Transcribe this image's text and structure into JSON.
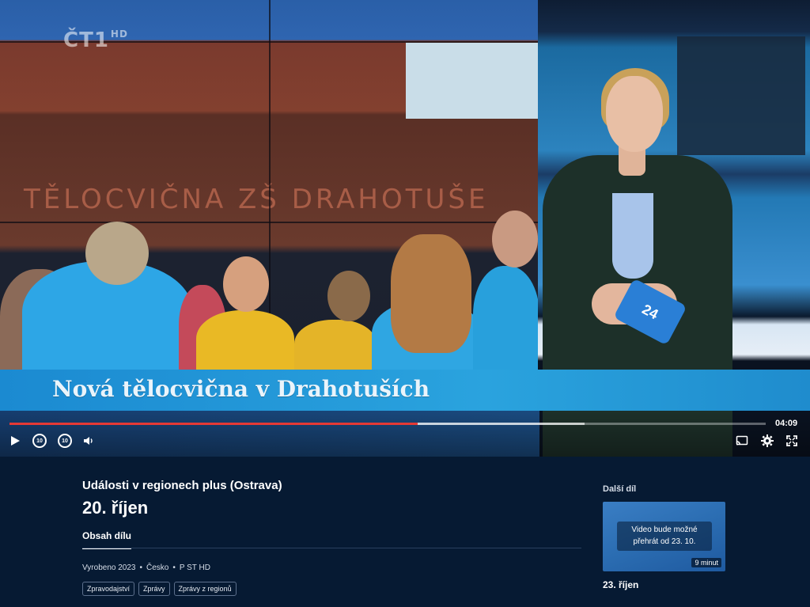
{
  "player": {
    "channel_logo": "ČT1",
    "channel_logo_hd": "HD",
    "background_sign": "TĚLOCVIČNA ZŠ DRAHOTUŠE",
    "studio_card": "24",
    "lower_third": "Nová tělocvična v Drahotuších",
    "time": "04:09",
    "progress": 0.54,
    "buffered": 0.76,
    "controls": {
      "play_icon": "play-icon",
      "rewind_label": "10",
      "forward_label": "10",
      "volume_icon": "volume-icon",
      "cast_icon": "cast-icon",
      "settings_icon": "gear-icon",
      "fullscreen_icon": "fullscreen-icon"
    },
    "accent_color": "#e53935"
  },
  "episode": {
    "show_title": "Události v regionech plus (Ostrava)",
    "title": "20. říjen",
    "tab": "Obsah dílu",
    "meta": [
      "Vyrobeno 2023",
      "Česko",
      "P ST HD"
    ],
    "tags": [
      "Zpravodajství",
      "Zprávy",
      "Zprávy z regionů"
    ]
  },
  "next": {
    "label": "Další díl",
    "overlay_line1": "Video bude možné",
    "overlay_line2": "přehrát od 23. 10.",
    "duration": "9 minut",
    "title": "23. říjen"
  }
}
